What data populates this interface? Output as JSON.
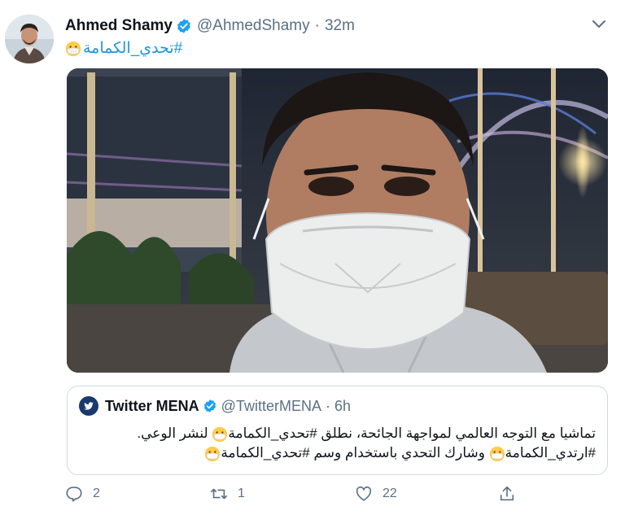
{
  "tweet": {
    "display_name": "Ahmed Shamy",
    "handle": "@AhmedShamy",
    "separator": "·",
    "time": "32m",
    "text_hashtag": "#تحدي_الكمامة",
    "text_emoji": "face-with-medical-mask"
  },
  "quote": {
    "display_name": "Twitter MENA",
    "handle": "@TwitterMENA",
    "separator": "·",
    "time": "6h",
    "line1_a": "تماشيا مع التوجه العالمي لمواجهة الجائحة، نطلق ",
    "line1_hashtag": "#تحدي_الكمامة",
    "line1_b": " لنشر الوعي.",
    "line2_hashtag1": "#ارتدي_الكمامة",
    "line2_a": " وشارك التحدي باستخدام وسم ",
    "line2_hashtag2": "#تحدي_الكمامة"
  },
  "actions": {
    "reply_count": "2",
    "retweet_count": "1",
    "like_count": "22"
  },
  "colors": {
    "link": "#1b95e0",
    "muted": "#5b7083",
    "verified": "#1da1f2",
    "border": "#cfd9de"
  },
  "icons": [
    "verified-badge-icon",
    "chevron-down-icon",
    "mask-emoji-icon",
    "reply-icon",
    "retweet-icon",
    "like-icon",
    "share-icon"
  ]
}
